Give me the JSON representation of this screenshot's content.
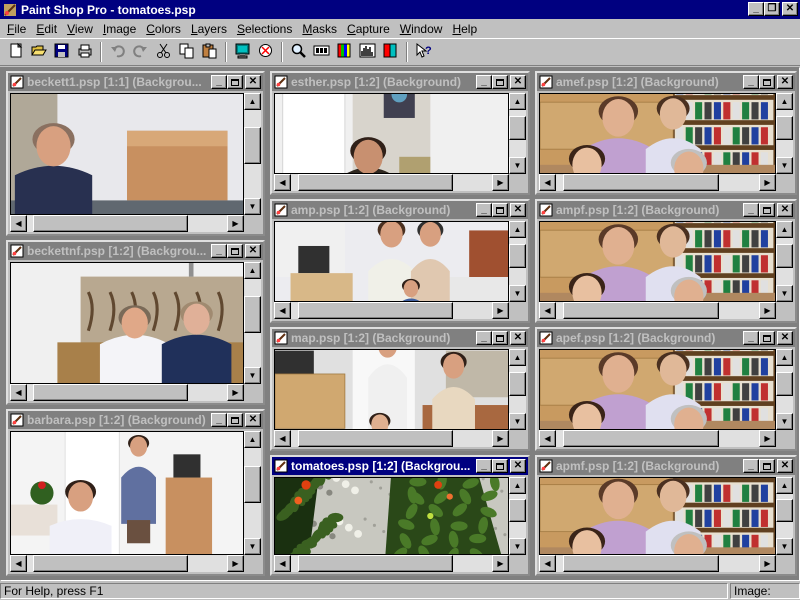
{
  "app": {
    "title": "Paint Shop Pro - tomatoes.psp",
    "min_glyph": "_",
    "restore_glyph": "❐",
    "close_glyph": "✕"
  },
  "menu": [
    {
      "label": "File",
      "ul": "F",
      "rest": "ile"
    },
    {
      "label": "Edit",
      "ul": "E",
      "rest": "dit"
    },
    {
      "label": "View",
      "ul": "V",
      "rest": "iew"
    },
    {
      "label": "Image",
      "ul": "I",
      "rest": "mage"
    },
    {
      "label": "Colors",
      "ul": "C",
      "rest": "olors"
    },
    {
      "label": "Layers",
      "ul": "L",
      "rest": "ayers"
    },
    {
      "label": "Selections",
      "ul": "S",
      "rest": "elections"
    },
    {
      "label": "Masks",
      "ul": "M",
      "rest": "asks"
    },
    {
      "label": "Capture",
      "ul": "C",
      "rest": "apture"
    },
    {
      "label": "Window",
      "ul": "W",
      "rest": "indow"
    },
    {
      "label": "Help",
      "ul": "H",
      "rest": "elp"
    }
  ],
  "toolbar_icons": [
    "new-icon",
    "open-icon",
    "save-icon",
    "print-icon",
    "sep",
    "undo-icon",
    "redo-icon",
    "cut-icon",
    "copy-icon",
    "paste-icon",
    "sep",
    "monitor-icon",
    "browse-icon",
    "sep",
    "zoom-icon",
    "toolbar-toggle-icon",
    "color-palette-icon",
    "histogram-icon",
    "layers-palette-icon",
    "sep",
    "context-help-icon"
  ],
  "documents": [
    {
      "id": "beckett1",
      "title": "beckett1.psp [1:1] (Backgrou...",
      "active": false,
      "scene": "man-box"
    },
    {
      "id": "esther",
      "title": "esther.psp [1:2] (Background)",
      "active": false,
      "scene": "esther"
    },
    {
      "id": "amef",
      "title": "amef.psp [1:2] (Background)",
      "active": false,
      "scene": "family-shelf"
    },
    {
      "id": "amp",
      "title": "amp.psp [1:2] (Background)",
      "active": false,
      "scene": "room-women"
    },
    {
      "id": "ampf",
      "title": "ampf.psp [1:2] (Background)",
      "active": false,
      "scene": "family-shelf"
    },
    {
      "id": "beckettnf",
      "title": "beckettnf.psp [1:2] (Backgrou...",
      "active": false,
      "scene": "two-men"
    },
    {
      "id": "map",
      "title": "map.psp [1:2] (Background)",
      "active": false,
      "scene": "kitchen"
    },
    {
      "id": "apef",
      "title": "apef.psp [1:2] (Background)",
      "active": false,
      "scene": "family-shelf"
    },
    {
      "id": "barbara",
      "title": "barbara.psp [1:2] (Background)",
      "active": false,
      "scene": "barbara"
    },
    {
      "id": "tomatoes",
      "title": "tomatoes.psp [1:2] (Backgrou...",
      "active": true,
      "scene": "tomatoes"
    },
    {
      "id": "apmf",
      "title": "apmf.psp [1:2] (Background)",
      "active": false,
      "scene": "family-shelf"
    }
  ],
  "status": {
    "help": "For Help, press F1",
    "image": "Image: None"
  },
  "colors": {
    "active_title": "#000080",
    "inactive_title": "#808080",
    "face": "#c0c0c0",
    "workspace": "#808080"
  }
}
